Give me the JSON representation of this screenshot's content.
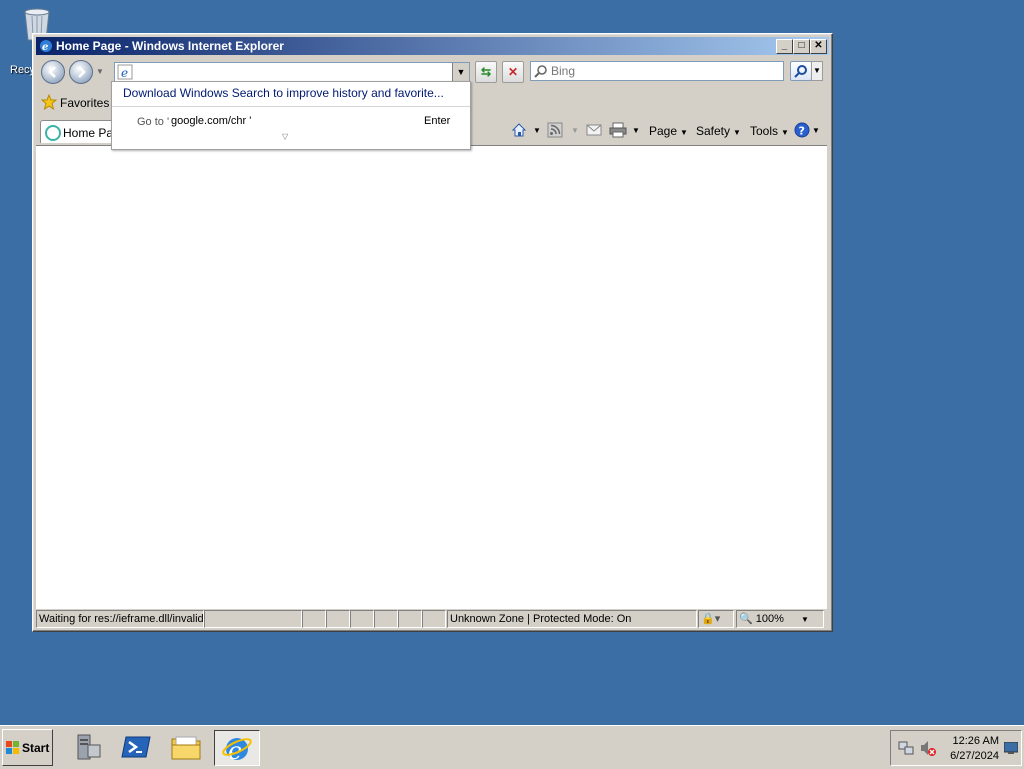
{
  "desktop": {
    "recycle_label": "Recycle Bin",
    "recycle_visible": "Recy"
  },
  "window": {
    "title": "Home Page - Windows Internet Explorer",
    "address_value": "",
    "search_placeholder": "Bing"
  },
  "favorites": {
    "label": "Favorites"
  },
  "tab": {
    "label": "Home Page"
  },
  "commands": {
    "page": "Page",
    "safety": "Safety",
    "tools": "Tools"
  },
  "autocomplete": {
    "windows_search": "Download Windows Search to improve history and favorite...",
    "goto_label": "Go to '",
    "goto_value": "google.com/chr '",
    "enter": "Enter"
  },
  "status": {
    "text": "Waiting for res://ieframe.dll/invalid",
    "zone": "Unknown Zone | Protected Mode: On",
    "zoom": "100%"
  },
  "taskbar": {
    "start": "Start",
    "time": "12:26 AM",
    "date": "6/27/2024"
  },
  "colors": {
    "desktop": "#3a6ea5",
    "titlebar": "#0a246a",
    "chrome": "#d4d0c8"
  }
}
